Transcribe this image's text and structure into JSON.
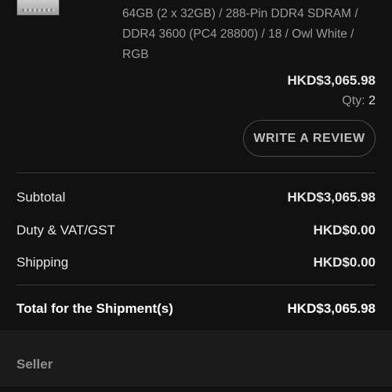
{
  "product": {
    "description": "64GB (2 x 32GB) / 288-Pin DDR4 SDRAM / DDR4 3600 (PC4 28800) / 18 / Owl White / RGB",
    "price": "HKD$3,065.98",
    "qty_label": "Qty:",
    "qty_value": "2"
  },
  "actions": {
    "write_review": "WRITE A REVIEW"
  },
  "summary": {
    "subtotal_label": "Subtotal",
    "subtotal_value": "HKD$3,065.98",
    "duty_label": "Duty & VAT/GST",
    "duty_value": "HKD$0.00",
    "shipping_label": "Shipping",
    "shipping_value": "HKD$0.00",
    "total_label": "Total for the Shipment(s)",
    "total_value": "HKD$3,065.98"
  },
  "seller": {
    "title": "Seller"
  },
  "colors": {
    "background": "#111111",
    "panel": "#1b1b1b",
    "muted_text": "#9b9b9b",
    "divider": "#3a3a3a"
  }
}
